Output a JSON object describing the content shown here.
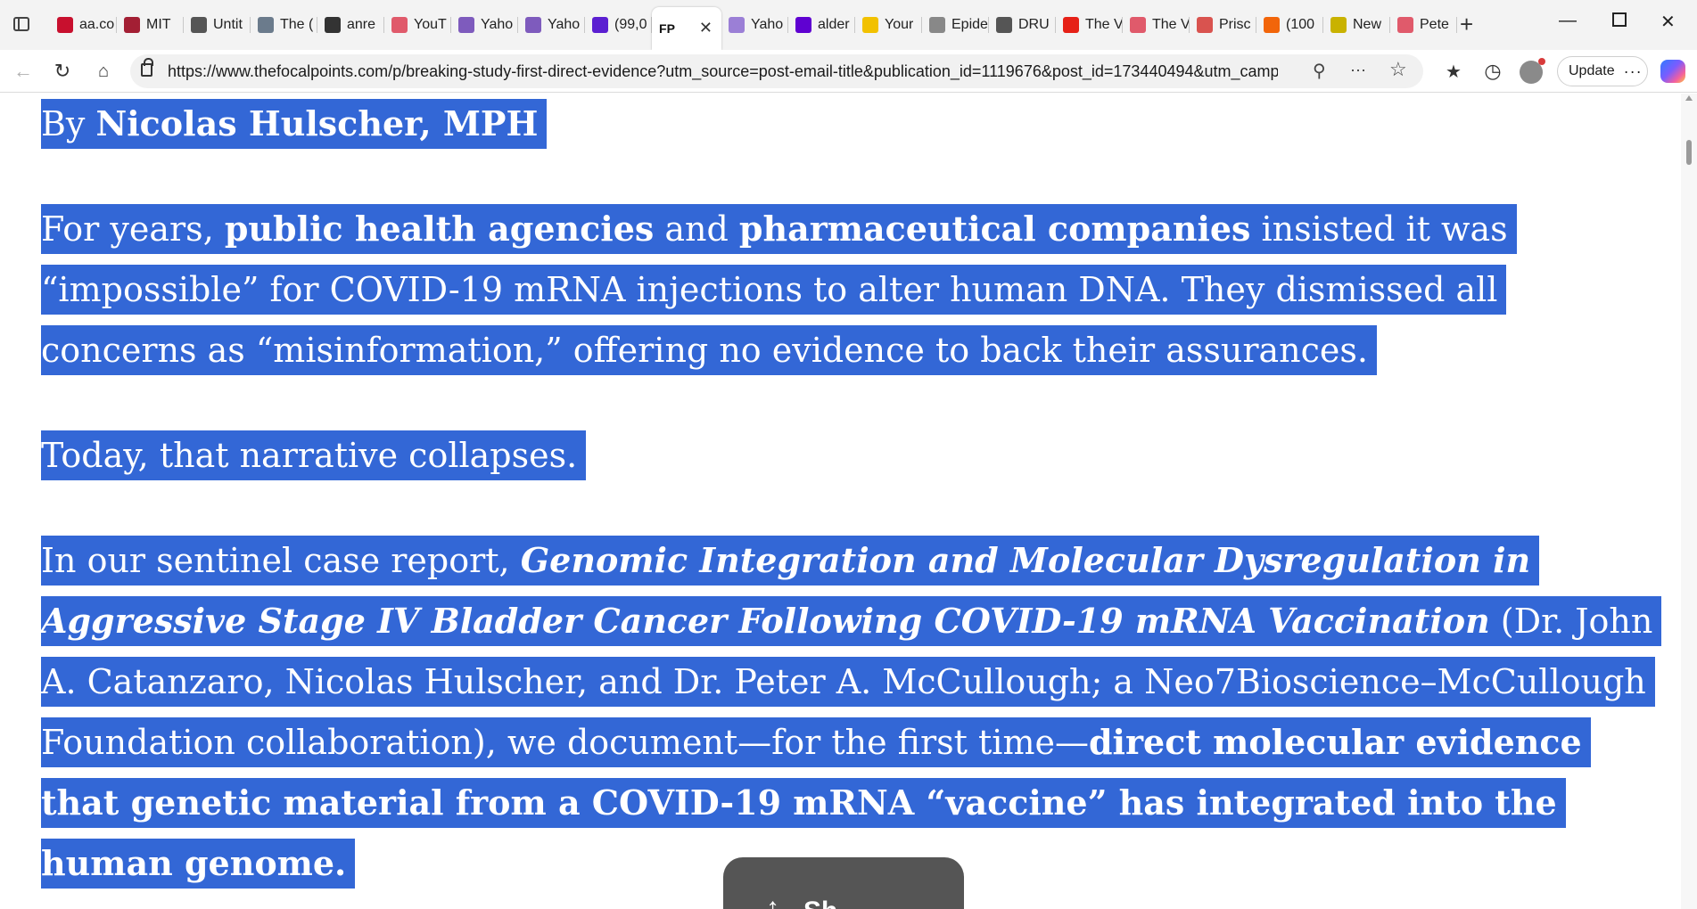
{
  "browser": {
    "tabs": [
      {
        "title": "aa.co",
        "icon": "aa-icon",
        "color": "#c8102e"
      },
      {
        "title": "MIT",
        "icon": "mit-icon",
        "color": "#a31f34"
      },
      {
        "title": "Untit",
        "icon": "globe-icon",
        "color": "#555555"
      },
      {
        "title": "The (",
        "icon": "gp-icon",
        "color": "#6b7b8c"
      },
      {
        "title": "anre",
        "icon": "medium-icon",
        "color": "#333333"
      },
      {
        "title": "YouT",
        "icon": "youtube-icon",
        "color": "#e05a6b"
      },
      {
        "title": "Yaho",
        "icon": "yahoo-icon",
        "color": "#7e5bbd"
      },
      {
        "title": "Yaho",
        "icon": "yahoo-icon",
        "color": "#7e5bbd"
      },
      {
        "title": "(99,0",
        "icon": "mail-icon",
        "color": "#5b1fd1"
      },
      {
        "title": "",
        "icon": "fp-icon",
        "color": "#111111",
        "active": true
      },
      {
        "title": "Yaho",
        "icon": "yahoo-feather-icon",
        "color": "#9b7fd6"
      },
      {
        "title": "alder",
        "icon": "yahoo-icon",
        "color": "#5f01d1"
      },
      {
        "title": "Your",
        "icon": "e-icon",
        "color": "#f2c100"
      },
      {
        "title": "Epide",
        "icon": "info-icon",
        "color": "#888888"
      },
      {
        "title": "DRU",
        "icon": "drudge-icon",
        "color": "#555555"
      },
      {
        "title": "The V",
        "icon": "youtube-icon",
        "color": "#e62117"
      },
      {
        "title": "The V",
        "icon": "youtube-icon",
        "color": "#e05a6b"
      },
      {
        "title": "Prisc",
        "icon": "bird-icon",
        "color": "#d9534f"
      },
      {
        "title": "(100",
        "icon": "bookmark-icon",
        "color": "#f2650a"
      },
      {
        "title": "New",
        "icon": "e-icon",
        "color": "#c9b200"
      },
      {
        "title": "Pete",
        "icon": "youtube-icon",
        "color": "#e05a6b"
      }
    ],
    "active_tab_favicon": "FP",
    "url": "https://www.thefocalpoints.com/p/breaking-study-first-direct-evidence?utm_source=post-email-title&publication_id=1119676&post_id=173440494&utm_campai...",
    "update_label": "Update",
    "more_label": "···"
  },
  "article": {
    "byline_prefix": "By ",
    "byline_name": "Nicolas Hulscher, MPH",
    "p1": {
      "t1": "For years, ",
      "b1": "public health agencies",
      "t2": " and ",
      "b2": "pharmaceutical companies",
      "t3": " insisted it was “impossible” for COVID-19 mRNA injections to alter human DNA. They dismissed all concerns as “misinformation,” offering no evidence to back their assurances."
    },
    "p2": "Today, that narrative collapses.",
    "p3": {
      "t1": "In our sentinel case report, ",
      "bi1": "Genomic Integration and Molecular Dysregulation in Aggressive Stage IV Bladder Cancer Following COVID-19 mRNA Vaccination",
      "t2": " (Dr. John A. Catanzaro, Nicolas Hulscher, and Dr. Peter A. McCullough; a Neo7Bioscience–McCullough Foundation collaboration), we document—for the first time—",
      "b1": "direct molecular evidence that genetic material from a COVID-19 mRNA “vaccine” has integrated into the human genome."
    },
    "share_label": "Sh"
  },
  "colors": {
    "selection": "#3367d6",
    "share_bg": "#555555"
  }
}
